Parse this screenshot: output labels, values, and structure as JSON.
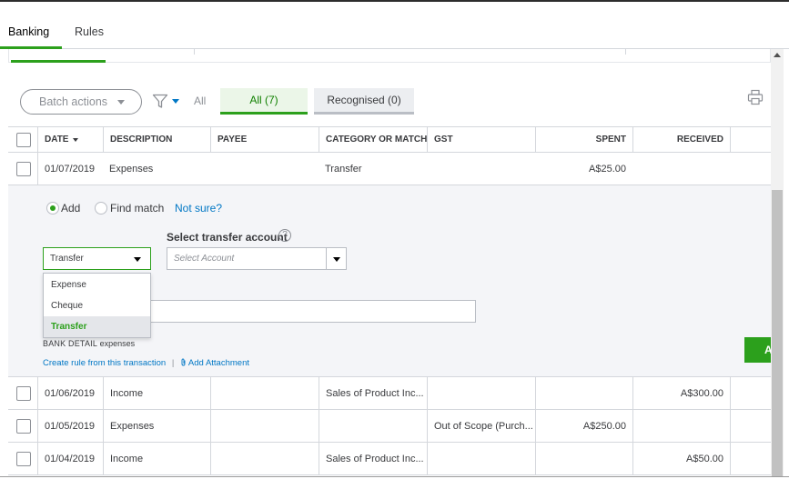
{
  "top_tabs": {
    "banking": "Banking",
    "rules": "Rules"
  },
  "toolbar": {
    "batch_actions": "Batch actions",
    "filter_all": "All",
    "tab_all": "All (7)",
    "tab_recognised": "Recognised (0)"
  },
  "table": {
    "headers": {
      "date": "DATE",
      "description": "DESCRIPTION",
      "payee": "PAYEE",
      "category": "CATEGORY OR MATCH",
      "gst": "GST",
      "spent": "SPENT",
      "received": "RECEIVED"
    },
    "rows": [
      {
        "date": "01/07/2019",
        "description": "Expenses",
        "payee": "",
        "category": "Transfer",
        "gst": "",
        "spent": "A$25.00",
        "received": ""
      },
      {
        "date": "01/06/2019",
        "description": "Income",
        "payee": "",
        "category": "Sales of Product Inc...",
        "gst": "",
        "spent": "",
        "received": "A$300.00"
      },
      {
        "date": "01/05/2019",
        "description": "Expenses",
        "payee": "",
        "category": "",
        "gst": "Out of Scope (Purch...",
        "spent": "A$250.00",
        "received": ""
      },
      {
        "date": "01/04/2019",
        "description": "Income",
        "payee": "",
        "category": "Sales of Product Inc...",
        "gst": "",
        "spent": "",
        "received": "A$50.00"
      }
    ]
  },
  "expanded": {
    "radio_add": "Add",
    "radio_find": "Find match",
    "not_sure": "Not sure?",
    "select_transfer_label": "Select transfer account",
    "help": "?",
    "type_value": "Transfer",
    "account_placeholder": "Select Account",
    "menu": [
      "Expense",
      "Cheque",
      "Transfer"
    ],
    "menu_selected": "Transfer",
    "bank_detail_label": "BANK DETAIL",
    "bank_detail_value": "expenses",
    "create_rule": "Create rule from this transaction",
    "add_attachment": "Add Attachment",
    "add_button": "A"
  },
  "colors": {
    "accent": "#2ca01c",
    "link": "#0077c5",
    "text": "#393a3d",
    "muted": "#8d9096"
  },
  "icons": [
    "filter-icon",
    "print-icon",
    "help-icon",
    "paperclip-icon",
    "chevron-down-icon",
    "scroll-up-icon"
  ]
}
